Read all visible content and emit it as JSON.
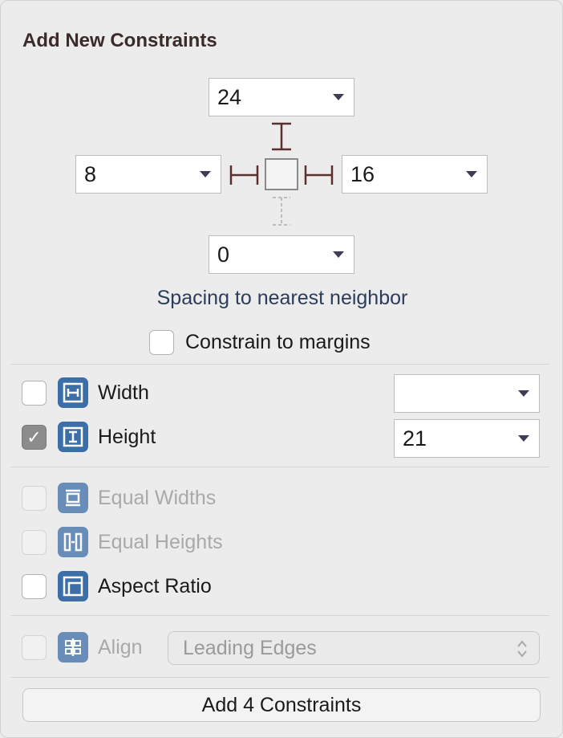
{
  "header": {
    "title": "Add New Constraints"
  },
  "spacing": {
    "top": "24",
    "left": "8",
    "right": "16",
    "bottom": "0",
    "caption": "Spacing to nearest neighbor"
  },
  "margins": {
    "label": "Constrain to margins",
    "checked": false
  },
  "size": {
    "width": {
      "label": "Width",
      "value": "",
      "checked": false
    },
    "height": {
      "label": "Height",
      "value": "21",
      "checked": true
    }
  },
  "relations": {
    "equal_widths": {
      "label": "Equal Widths",
      "enabled": false
    },
    "equal_heights": {
      "label": "Equal Heights",
      "enabled": false
    },
    "aspect_ratio": {
      "label": "Aspect Ratio",
      "enabled": true
    }
  },
  "align": {
    "label": "Align",
    "option": "Leading Edges",
    "enabled": false
  },
  "footer": {
    "add_button": "Add 4 Constraints"
  },
  "colors": {
    "accent_icon": "#3c6ea8",
    "strut": "#5a2f2f",
    "caption": "#2c3d5c"
  }
}
